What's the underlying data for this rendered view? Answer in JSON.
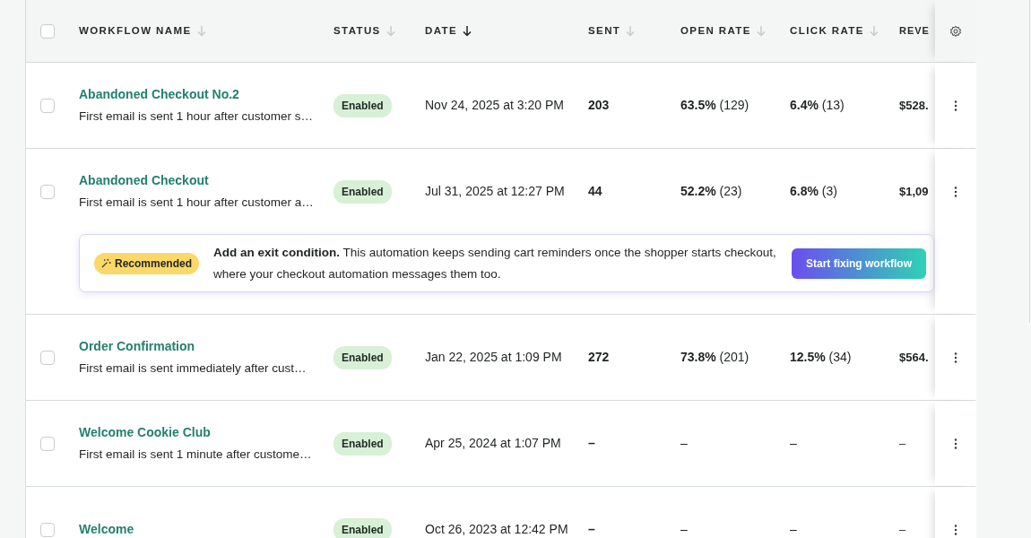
{
  "table": {
    "select_all": {
      "checked": false
    },
    "columns": [
      {
        "label": "WORKFLOW NAME",
        "sort_active": false
      },
      {
        "label": "STATUS",
        "sort_active": false
      },
      {
        "label": "DATE",
        "sort_active": true
      },
      {
        "label": "SENT",
        "sort_active": false
      },
      {
        "label": "OPEN RATE",
        "sort_active": false
      },
      {
        "label": "CLICK RATE",
        "sort_active": false
      },
      {
        "label": "REVE"
      }
    ],
    "rows": [
      {
        "checked": false,
        "name": "Abandoned Checkout No.2",
        "description": "First email is sent 1 hour after customer s…",
        "status": "Enabled",
        "date": "Nov 24, 2025 at 3:20 PM",
        "sent": "203",
        "open_rate": "63.5%",
        "open_count": "(129)",
        "click_rate": "6.4%",
        "click_count": "(13)",
        "revenue": "$528."
      },
      {
        "checked": false,
        "name": "Abandoned Checkout",
        "description": "First email is sent 1 hour after customer a…",
        "status": "Enabled",
        "date": "Jul 31, 2025 at 12:27 PM",
        "sent": "44",
        "open_rate": "52.2%",
        "open_count": "(23)",
        "click_rate": "6.8%",
        "click_count": "(3)",
        "revenue": "$1,09",
        "recommendation": {
          "badge": "Recommended",
          "title": "Add an exit condition.",
          "text": "This automation keeps sending cart reminders once the shopper starts checkout, where your checkout automation messages them too.",
          "button": "Start fixing workflow"
        }
      },
      {
        "checked": false,
        "name": "Order Confirmation",
        "description": "First email is sent immediately after cust…",
        "status": "Enabled",
        "date": "Jan 22, 2025 at 1:09 PM",
        "sent": "272",
        "open_rate": "73.8%",
        "open_count": "(201)",
        "click_rate": "12.5%",
        "click_count": "(34)",
        "revenue": "$564."
      },
      {
        "checked": false,
        "name": "Welcome Cookie Club",
        "description": "First email is sent 1 minute after custome…",
        "status": "Enabled",
        "date": "Apr 25, 2024 at 1:07 PM",
        "sent": "–",
        "open_rate": "–",
        "click_rate": "–",
        "revenue": "–"
      },
      {
        "checked": false,
        "name": "Welcome",
        "status": "Enabled",
        "date": "Oct 26, 2023 at 12:42 PM",
        "sent": "–",
        "open_rate": "–",
        "click_rate": "–",
        "revenue": "–"
      }
    ]
  }
}
